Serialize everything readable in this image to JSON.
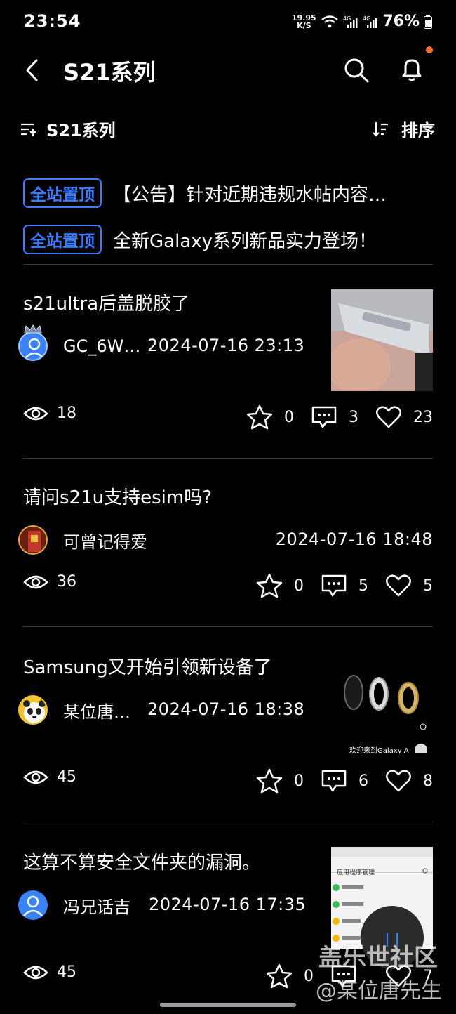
{
  "status_bar": {
    "time": "23:54",
    "net_speed": "19.95 K/S",
    "battery": "76%"
  },
  "header": {
    "title": "S21系列"
  },
  "filter": {
    "category": "S21系列",
    "sort_label": "排序"
  },
  "pinned": [
    {
      "badge": "全站置顶",
      "text": "【公告】针对近期违规水帖内容…"
    },
    {
      "badge": "全站置顶",
      "text": "全新Galaxy系列新品实力登场！"
    }
  ],
  "posts": [
    {
      "title": "s21ultra后盖脱胶了",
      "author": "GC_6W…",
      "date": "2024-07-16 23:13",
      "views": "18",
      "favorites": "0",
      "comments": "3",
      "likes": "23"
    },
    {
      "title": "请问s21u支持esim吗?",
      "author": "可曾记得爱",
      "date": "2024-07-16 18:48",
      "views": "36",
      "favorites": "0",
      "comments": "5",
      "likes": "5"
    },
    {
      "title": "Samsung又开始引领新设备了",
      "author": "某位唐…",
      "date": "2024-07-16 18:38",
      "views": "45",
      "favorites": "0",
      "comments": "6",
      "likes": "8",
      "thumb_caption": "欢迎来到Galaxy A"
    },
    {
      "title": "这算不算安全文件夹的漏洞。",
      "author": "冯兄话吉",
      "date": "2024-07-16 17:35",
      "views": "45",
      "favorites": "0",
      "comments": "",
      "likes": "7",
      "thumb_caption": "应用程序管理"
    }
  ],
  "watermark": {
    "line1": "盖乐世社区",
    "line2": "@某位唐先生"
  },
  "colors": {
    "accent": "#3a7bff",
    "notification_dot": "#f36f2b"
  }
}
